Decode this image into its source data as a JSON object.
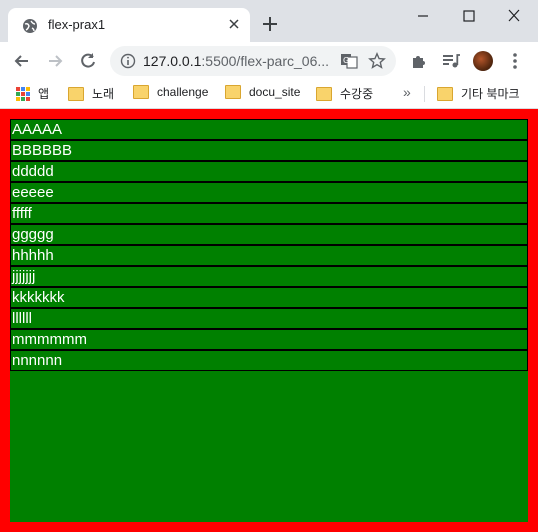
{
  "tab": {
    "title": "flex-prax1"
  },
  "address": {
    "host": "127.0.0.1",
    "rest": ":5500/flex-parc_06..."
  },
  "bookmarks": {
    "apps": "앱",
    "items": [
      "노래",
      "challenge",
      "docu_site",
      "수강중"
    ],
    "more": "»",
    "other": "기타 북마크"
  },
  "page": {
    "items": [
      "AAAAA",
      "BBBBBB",
      "ddddd",
      "eeeee",
      "fffff",
      "ggggg",
      "hhhhh",
      "jjjjjjj",
      "kkkkkkk",
      "llllll",
      "mmmmmm",
      "nnnnnn"
    ]
  },
  "colors": {
    "container_border": "#ff0000",
    "container_bg": "#008000",
    "item_border": "#000000",
    "item_text": "#ffffff"
  }
}
